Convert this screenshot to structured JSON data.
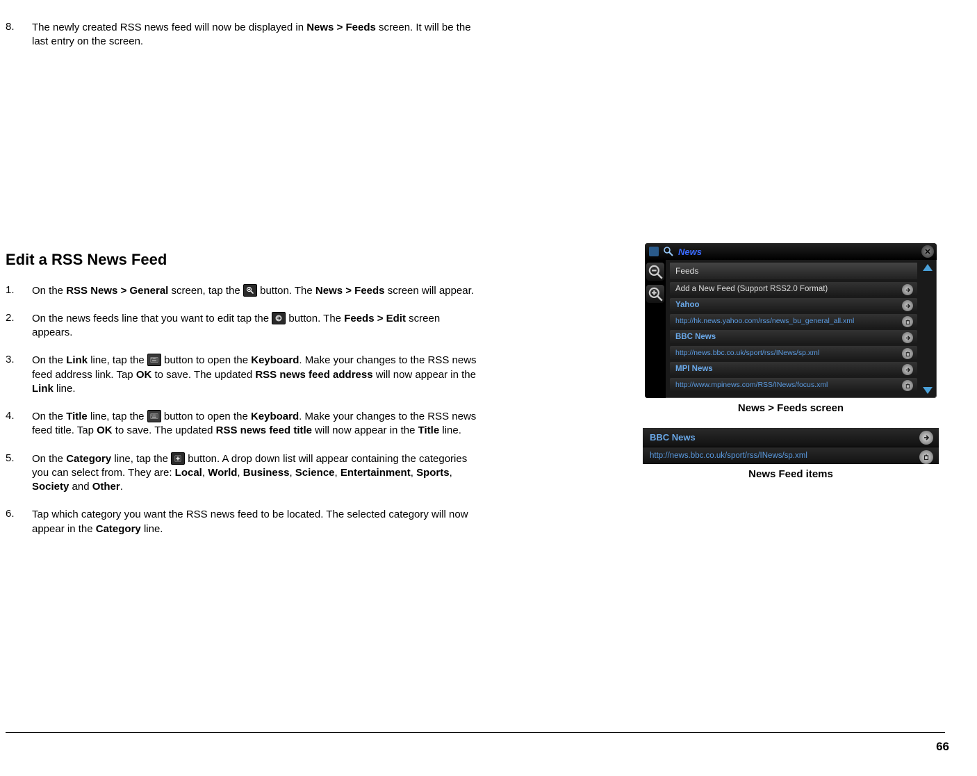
{
  "step8": {
    "num": "8.",
    "text_a": "The newly created RSS news feed will now be displayed in ",
    "bold_a": "News > Feeds",
    "text_b": " screen.  It will be the last entry on the screen."
  },
  "heading": "Edit a RSS News Feed",
  "steps": [
    {
      "num": "1.",
      "parts": [
        {
          "t": "On the "
        },
        {
          "b": "RSS News > General"
        },
        {
          "t": " screen, tap the "
        },
        {
          "icon": "magnify-plus"
        },
        {
          "t": " button.  The "
        },
        {
          "b": "News > Feeds"
        },
        {
          "t": " screen will appear."
        }
      ]
    },
    {
      "num": "2.",
      "parts": [
        {
          "t": "On the news feeds line that you want to edit tap the "
        },
        {
          "icon": "arrow-right"
        },
        {
          "t": " button.  The "
        },
        {
          "b": "Feeds > Edit"
        },
        {
          "t": " screen appears."
        }
      ]
    },
    {
      "num": "3.",
      "parts": [
        {
          "t": "On the "
        },
        {
          "b": "Link"
        },
        {
          "t": " line, tap the "
        },
        {
          "icon": "keyboard"
        },
        {
          "t": " button to open the "
        },
        {
          "b": "Keyboard"
        },
        {
          "t": ".  Make your changes to the RSS news feed address link.  Tap "
        },
        {
          "b": "OK"
        },
        {
          "t": " to save.  The updated "
        },
        {
          "b": "RSS news feed address"
        },
        {
          "t": " will now appear in the "
        },
        {
          "b": "Link"
        },
        {
          "t": " line."
        }
      ]
    },
    {
      "num": "4.",
      "parts": [
        {
          "t": "On the "
        },
        {
          "b": "Title"
        },
        {
          "t": " line, tap the "
        },
        {
          "icon": "keyboard"
        },
        {
          "t": " button to open the "
        },
        {
          "b": "Keyboard"
        },
        {
          "t": ".  Make your changes to the RSS news feed title.  Tap "
        },
        {
          "b": "OK"
        },
        {
          "t": " to save.  The updated "
        },
        {
          "b": "RSS news feed title"
        },
        {
          "t": " will now appear in the "
        },
        {
          "b": "Title"
        },
        {
          "t": " line."
        }
      ]
    },
    {
      "num": "5.",
      "parts": [
        {
          "t": "On the "
        },
        {
          "b": "Category"
        },
        {
          "t": " line, tap the "
        },
        {
          "icon": "plus"
        },
        {
          "t": " button.  A drop down list will appear containing the categories you can select from.  They are:  "
        },
        {
          "b": "Local"
        },
        {
          "t": ", "
        },
        {
          "b": "World"
        },
        {
          "t": ", "
        },
        {
          "b": "Business"
        },
        {
          "t": ", "
        },
        {
          "b": "Science"
        },
        {
          "t": ", "
        },
        {
          "b": "Entertainment"
        },
        {
          "t": ", "
        },
        {
          "b": "Sports"
        },
        {
          "t": ", "
        },
        {
          "b": "Society"
        },
        {
          "t": " and "
        },
        {
          "b": "Other"
        },
        {
          "t": "."
        }
      ]
    },
    {
      "num": "6.",
      "parts": [
        {
          "t": "Tap which category you want the RSS news feed to be located.  The selected category will now appear in the "
        },
        {
          "b": "Category"
        },
        {
          "t": " line."
        }
      ]
    }
  ],
  "screenshot1": {
    "title": "News",
    "feeds_header": "Feeds",
    "add_label": "Add a New Feed (Support RSS2.0 Format)",
    "rows": [
      {
        "name": "Yahoo",
        "url": "http://hk.news.yahoo.com/rss/news_bu_general_all.xml"
      },
      {
        "name": "BBC News",
        "url": "http://news.bbc.co.uk/sport/rss/INews/sp.xml"
      },
      {
        "name": "MPI News",
        "url": "http://www.mpinews.com/RSS/INews/focus.xml"
      }
    ]
  },
  "caption1": "News > Feeds screen",
  "screenshot2": {
    "name": "BBC News",
    "url": "http://news.bbc.co.uk/sport/rss/INews/sp.xml"
  },
  "caption2": "News Feed items",
  "page_number": "66"
}
